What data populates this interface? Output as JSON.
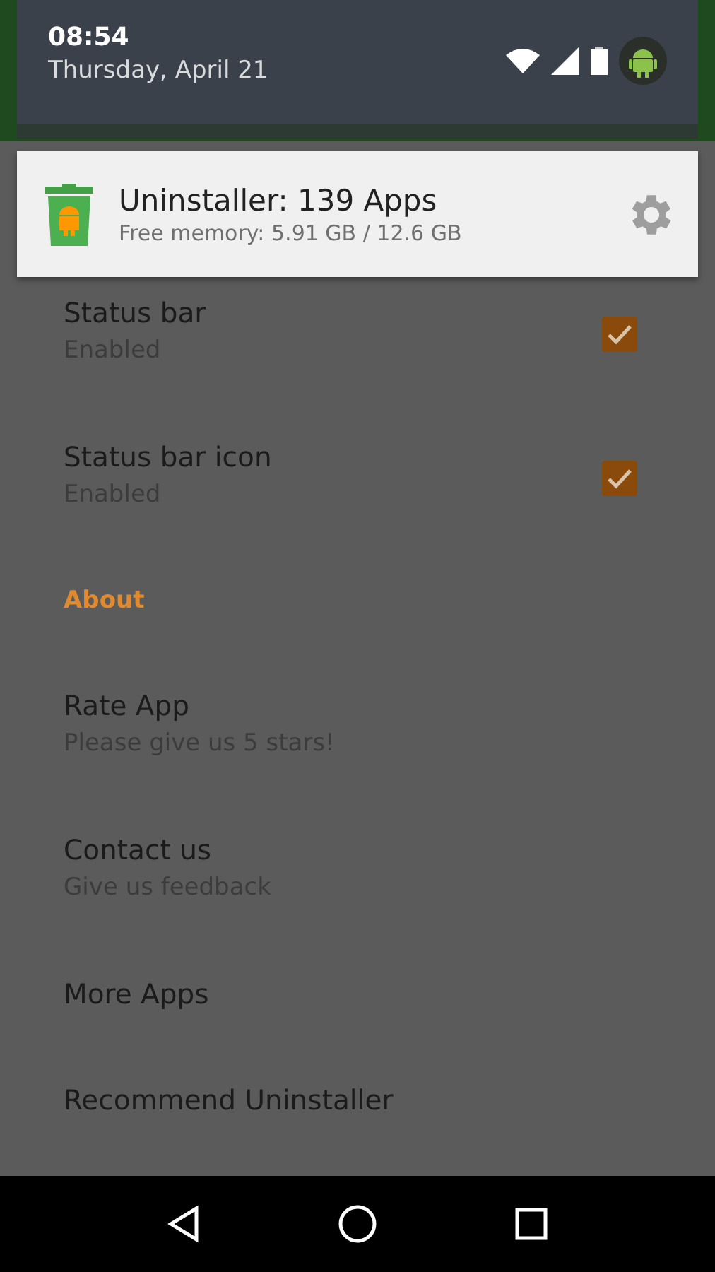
{
  "status_header": {
    "time": "08:54",
    "date": "Thursday, April 21"
  },
  "notification": {
    "title": "Uninstaller: 139 Apps",
    "subtitle": "Free memory: 5.91 GB / 12.6 GB"
  },
  "settings": [
    {
      "kind": "checkbox",
      "title": "Status bar",
      "summary": "Enabled",
      "checked": true
    },
    {
      "kind": "checkbox",
      "title": "Status bar icon",
      "summary": "Enabled",
      "checked": true
    },
    {
      "kind": "header",
      "title": "About"
    },
    {
      "kind": "item",
      "title": "Rate App",
      "summary": "Please give us 5 stars!"
    },
    {
      "kind": "item",
      "title": "Contact us",
      "summary": "Give us feedback"
    },
    {
      "kind": "item",
      "title": "More Apps"
    },
    {
      "kind": "item",
      "title": "Recommend Uninstaller"
    }
  ]
}
